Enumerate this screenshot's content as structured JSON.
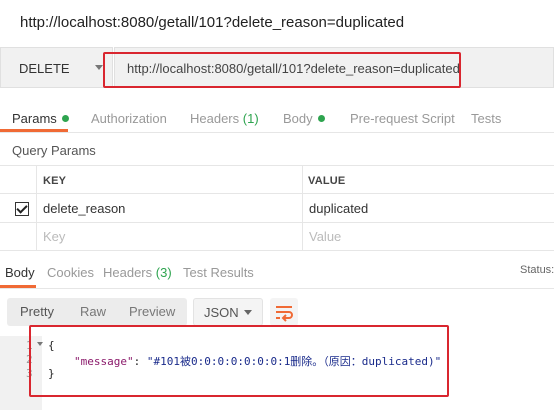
{
  "window": {
    "title": "http://localhost:8080/getall/101?delete_reason=duplicated"
  },
  "request": {
    "method": "DELETE",
    "url": "http://localhost:8080/getall/101?delete_reason=duplicated"
  },
  "request_tabs": [
    {
      "label": "Params",
      "active": true,
      "indicator": "green-dot"
    },
    {
      "label": "Authorization"
    },
    {
      "label": "Headers",
      "count": "(1)"
    },
    {
      "label": "Body",
      "indicator": "green-dot"
    },
    {
      "label": "Pre-request Script"
    },
    {
      "label": "Tests"
    }
  ],
  "params": {
    "section_label": "Query Params",
    "headers": {
      "key": "KEY",
      "value": "VALUE"
    },
    "rows": [
      {
        "checked": true,
        "key": "delete_reason",
        "value": "duplicated"
      }
    ],
    "new_row": {
      "key_placeholder": "Key",
      "value_placeholder": "Value"
    }
  },
  "response_tabs": [
    {
      "label": "Body",
      "active": true
    },
    {
      "label": "Cookies"
    },
    {
      "label": "Headers",
      "count": "(3)"
    },
    {
      "label": "Test Results"
    }
  ],
  "status_label": "Status:",
  "response_toolbar": {
    "views": [
      "Pretty",
      "Raw",
      "Preview"
    ],
    "format": "JSON",
    "wrap_icon": "wrap-lines-icon"
  },
  "response_body": {
    "line_numbers": [
      "1",
      "2",
      "3"
    ],
    "open_brace": "{",
    "key": "\"message\"",
    "colon": ": ",
    "value": "\"#101被0:0:0:0:0:0:0:1删除。（原因：duplicated)\"",
    "close_brace": "}"
  },
  "colors": {
    "accent": "#f06a35",
    "indicator": "#2ea44f",
    "highlight": "#d9262f"
  }
}
